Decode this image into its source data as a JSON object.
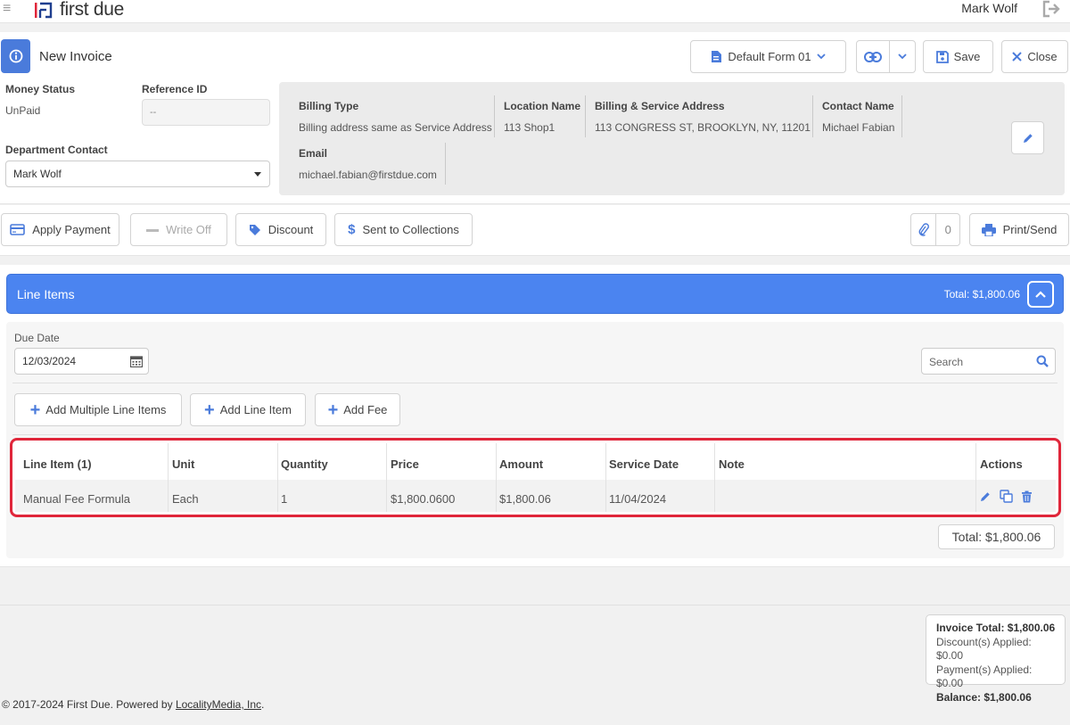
{
  "app": {
    "brand": "first due",
    "user_name": "Mark Wolf"
  },
  "header": {
    "title": "New Invoice",
    "form_select": "Default Form 01",
    "save_label": "Save",
    "close_label": "Close"
  },
  "info": {
    "money_status_label": "Money Status",
    "money_status_value": "UnPaid",
    "reference_id_label": "Reference ID",
    "reference_id_placeholder": "--",
    "department_contact_label": "Department Contact",
    "department_contact_value": "Mark Wolf"
  },
  "billing": {
    "billing_type_label": "Billing Type",
    "billing_type_value": "Billing address same as Service Address",
    "location_name_label": "Location Name",
    "location_name_value": "113 Shop1",
    "address_label": "Billing & Service Address",
    "address_value": "113 CONGRESS ST, BROOKLYN, NY, 11201",
    "contact_name_label": "Contact Name",
    "contact_name_value": "Michael Fabian",
    "email_label": "Email",
    "email_value": "michael.fabian@firstdue.com"
  },
  "actions": {
    "apply_payment": "Apply Payment",
    "write_off": "Write Off",
    "discount": "Discount",
    "sent_to_collections": "Sent to Collections",
    "attachment_count": "0",
    "print_send": "Print/Send"
  },
  "line_items": {
    "title": "Line Items",
    "header_total": "Total: $1,800.06",
    "due_date_label": "Due Date",
    "due_date_value": "12/03/2024",
    "search_placeholder": "Search",
    "add_multiple": "Add Multiple Line Items",
    "add_line_item": "Add Line Item",
    "add_fee": "Add Fee",
    "columns": [
      "Line Item (1)",
      "Unit",
      "Quantity",
      "Price",
      "Amount",
      "Service Date",
      "Note",
      "Actions"
    ],
    "rows": [
      {
        "line_item": "Manual Fee Formula",
        "unit": "Each",
        "quantity": "1",
        "price": "$1,800.0600",
        "amount": "$1,800.06",
        "service_date": "11/04/2024",
        "note": ""
      }
    ],
    "footer_total": "Total: $1,800.06"
  },
  "summary": {
    "invoice_total": "Invoice Total: $1,800.06",
    "discounts_applied": "Discount(s) Applied: $0.00",
    "payments_applied": "Payment(s) Applied: $0.00",
    "balance": "Balance: $1,800.06"
  },
  "footer": {
    "copyright": "© 2017-2024 First Due. Powered by ",
    "link_text": "LocalityMedia, Inc",
    "suffix": "."
  },
  "colors": {
    "accent": "#4b84f0",
    "highlight_border": "#e0263a",
    "icon_blue": "#4a7bdb"
  }
}
